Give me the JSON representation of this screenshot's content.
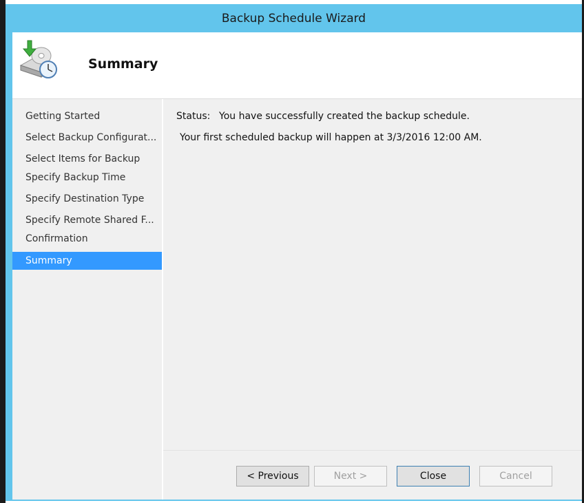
{
  "window": {
    "title": "Backup Schedule Wizard"
  },
  "header": {
    "title": "Summary",
    "icon": "backup-schedule-icon"
  },
  "sidebar": {
    "items": [
      {
        "label": "Getting Started",
        "selected": false
      },
      {
        "label": "Select Backup Configurat...",
        "selected": false
      },
      {
        "label": "Select Items for Backup",
        "selected": false
      },
      {
        "label": "Specify Backup Time",
        "selected": false
      },
      {
        "label": "Specify Destination Type",
        "selected": false
      },
      {
        "label": "Specify Remote Shared F...",
        "selected": false
      },
      {
        "label": "Confirmation",
        "selected": false
      },
      {
        "label": "Summary",
        "selected": true
      }
    ]
  },
  "content": {
    "status_label": "Status:",
    "status_text": "You have successfully created the backup schedule.",
    "detail_text": "Your first scheduled backup will happen at 3/3/2016 12:00 AM."
  },
  "buttons": {
    "previous": "< Previous",
    "next": "Next >",
    "close": "Close",
    "cancel": "Cancel"
  },
  "colors": {
    "title_bar": "#62c5ec",
    "selected_item": "#3399ff",
    "panel_background": "#f0f0f0"
  }
}
